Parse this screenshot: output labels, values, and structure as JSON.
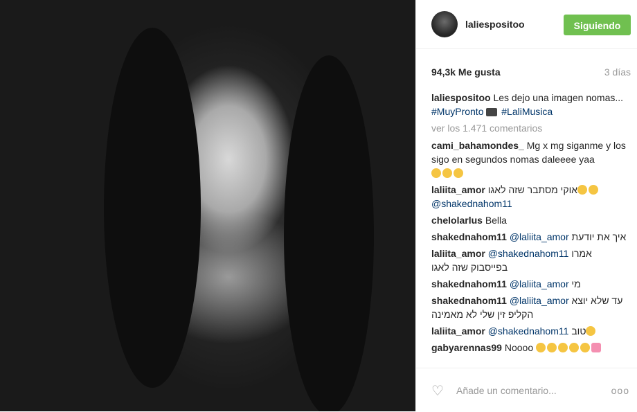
{
  "post": {
    "username": "laliespositoo",
    "follow_label": "Siguiendo",
    "likes": "94,3k Me gusta",
    "time": "3 días"
  },
  "caption": {
    "user": "laliespositoo",
    "text": "Les dejo una imagen nomas...",
    "tag1": "#MuyPronto",
    "tag2": "#LaliMusica"
  },
  "view_all": "ver los 1.471 comentarios",
  "comments": [
    {
      "user": "cami_bahamondes_",
      "text": "Mg x mg siganme y los sigo en segundos nomas daleeee yaa"
    },
    {
      "user": "laliita_amor",
      "text": "אוקי מסתבר שזה לאגו",
      "mention": "@shakednahom11"
    },
    {
      "user": "chelolarlus",
      "text": "Bella"
    },
    {
      "user": "shakednahom11",
      "mention": "@laliita_amor",
      "text": "איך את יודעת"
    },
    {
      "user": "laliita_amor",
      "mention": "@shakednahom11",
      "text": "אמרו בפייסבוק שזה לאגו"
    },
    {
      "user": "shakednahom11",
      "mention": "@laliita_amor",
      "text": "מי"
    },
    {
      "user": "shakednahom11",
      "mention": "@laliita_amor",
      "text": "עד שלא יוצא הקליפ זין שלי לא מאמינה"
    },
    {
      "user": "laliita_amor",
      "mention": "@shakednahom11",
      "text": "טוב"
    },
    {
      "user": "gabyarennas99",
      "text": "Noooo"
    }
  ],
  "add_comment_placeholder": "Añade un comentario...",
  "icons": {
    "like": "heart-outline-icon",
    "more": "more-options-icon"
  },
  "colors": {
    "follow_button": "#70c050",
    "link": "#003569",
    "muted": "#999999"
  }
}
